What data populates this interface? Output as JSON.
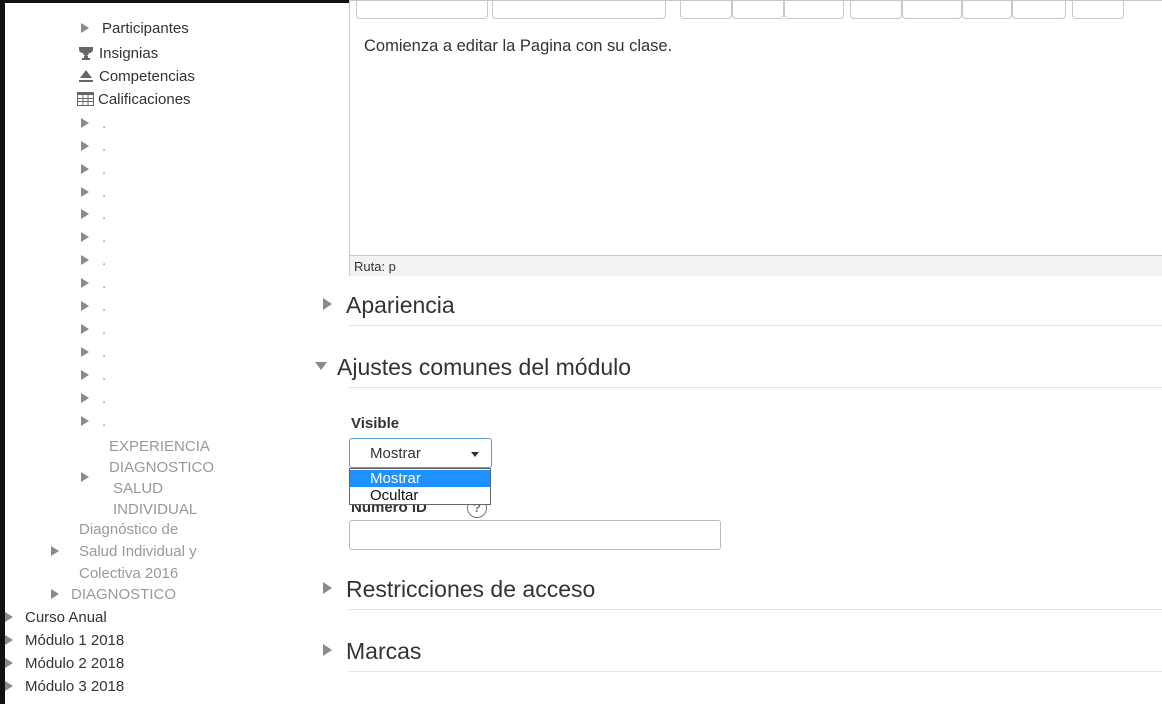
{
  "sidebar": {
    "participantes": "Participantes",
    "insignias": "Insignias",
    "competencias": "Competencias",
    "calificaciones": "Calificaciones",
    "dot": ".",
    "experiencia_lines": [
      "EXPERIENCIA",
      "DIAGNOSTICO",
      "SALUD",
      "INDIVIDUAL"
    ],
    "diagnostico_lines": [
      "Diagnóstico de",
      "Salud Individual y",
      "Colectiva 2016"
    ],
    "diagnostico_upper": "DIAGNOSTICO",
    "courses": [
      "Curso Anual",
      "Módulo 1 2018",
      "Módulo 2 2018",
      "Módulo 3 2018"
    ]
  },
  "editor": {
    "content": "Comienza a editar la Pagina con su clase.",
    "path": "Ruta: p"
  },
  "sections": {
    "apariencia": "Apariencia",
    "ajustes": "Ajustes comunes del módulo",
    "restricciones": "Restricciones de acceso",
    "marcas": "Marcas"
  },
  "visible": {
    "label": "Visible",
    "selected": "Mostrar",
    "options": [
      "Mostrar",
      "Ocultar"
    ]
  },
  "idnumber": {
    "label_visible": "Número ID",
    "value": ""
  },
  "icons": {
    "triangle": "triangle-right-icon",
    "trophy": "trophy-icon",
    "competencias": "competencies-icon",
    "grades": "grades-table-icon",
    "help": "help-icon"
  }
}
